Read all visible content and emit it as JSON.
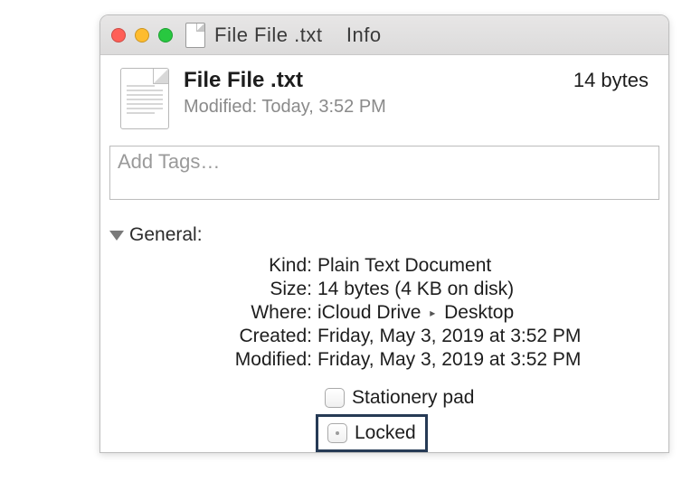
{
  "titlebar": {
    "filename": "File File .txt",
    "suffix": "Info"
  },
  "header": {
    "name": "File File",
    "ext": ".txt",
    "size": "14 bytes",
    "modified_label": "Modified:",
    "modified_value": "Today, 3:52 PM"
  },
  "tags": {
    "placeholder": "Add Tags…"
  },
  "section": {
    "general_label": "General:"
  },
  "kv": {
    "kind_label": "Kind:",
    "kind_value": "Plain Text Document",
    "size_label": "Size:",
    "size_value": "14 bytes (4 KB on disk)",
    "where_label": "Where:",
    "where_first": "iCloud Drive",
    "where_second": "Desktop",
    "created_label": "Created:",
    "created_value": "Friday, May 3, 2019 at 3:52 PM",
    "modified_label": "Modified:",
    "modified_value": "Friday, May 3, 2019 at 3:52 PM"
  },
  "checks": {
    "stationery_label": "Stationery pad",
    "locked_label": "Locked"
  }
}
